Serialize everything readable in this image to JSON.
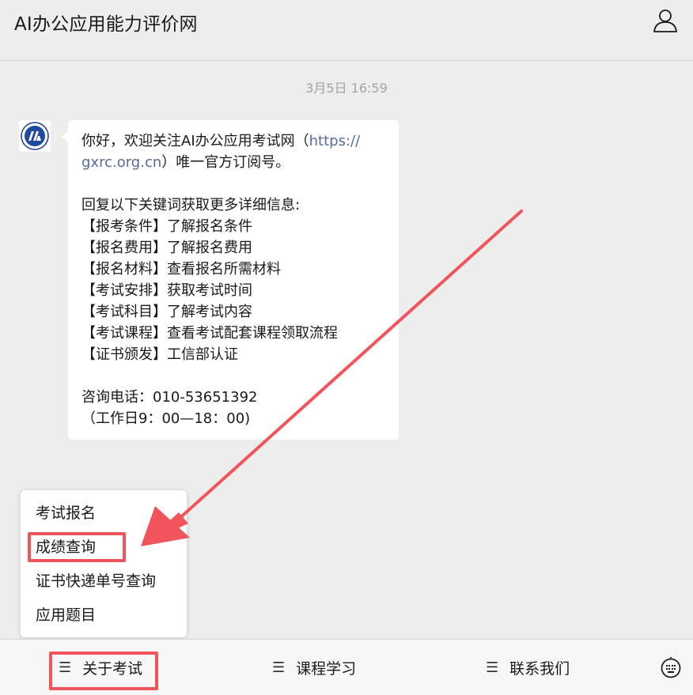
{
  "header": {
    "title": "AI办公应用能力评价网",
    "user_icon": "user-icon"
  },
  "chat": {
    "timestamp": "3月5日 16:59",
    "avatar_icon": "account-logo",
    "message": {
      "line1_pre": "你好，欢迎关注AI办公应用考试网（",
      "link_part1": "https://",
      "link_part2": "gxrc.org.cn",
      "line2_post": "）唯一官方订阅号。",
      "intro": "回复以下关键词获取更多详细信息:",
      "keywords": [
        "【报考条件】了解报名条件",
        "【报名费用】了解报名费用",
        "【报名材料】查看报名所需材料",
        "【考试安排】获取考试时间",
        "【考试科目】了解考试内容",
        "【考试课程】查看考试配套课程领取流程",
        "【证书颁发】工信部认证"
      ],
      "phone": "咨询电话：010-53651392",
      "hours": "（工作日9：00—18：00)"
    }
  },
  "popup_menu": {
    "items": [
      "考试报名",
      "成绩查询",
      "证书快递单号查询",
      "应用题目"
    ],
    "highlighted_item": "成绩查询"
  },
  "bottom_menu": {
    "items": [
      "关于考试",
      "课程学习",
      "联系我们"
    ],
    "menu_icon": "hamburger-icon",
    "keyboard_icon": "keyboard-icon"
  },
  "annotation": {
    "highlight_color": "#f2545b"
  }
}
